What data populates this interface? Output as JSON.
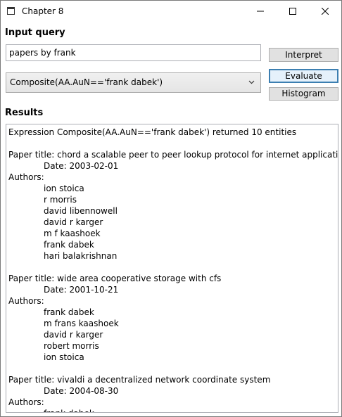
{
  "window": {
    "title": "Chapter 8",
    "minimize_glyph": "—",
    "maximize_glyph": "☐",
    "close_glyph": "✕"
  },
  "input_section": {
    "label": "Input query",
    "query_value": "papers by frank",
    "interpret_label": "Interpret"
  },
  "combo": {
    "selected": "Composite(AA.AuN=='frank dabek')"
  },
  "buttons": {
    "evaluate_label": "Evaluate",
    "histogram_label": "Histogram"
  },
  "results": {
    "label": "Results",
    "summary": "Expression Composite(AA.AuN=='frank dabek') returned 10 entities",
    "papers": [
      {
        "title_line": "Paper title: chord a scalable peer to peer lookup protocol for internet applications",
        "date_line": "Date: 2003-02-01",
        "authors_label": "Authors:",
        "authors": [
          "ion stoica",
          "r morris",
          "david libennowell",
          "david r karger",
          "m f kaashoek",
          "frank dabek",
          "hari balakrishnan"
        ]
      },
      {
        "title_line": "Paper title: wide area cooperative storage with cfs",
        "date_line": "Date: 2001-10-21",
        "authors_label": "Authors:",
        "authors": [
          "frank dabek",
          "m frans kaashoek",
          "david r karger",
          "robert morris",
          "ion stoica"
        ]
      },
      {
        "title_line": "Paper title: vivaldi a decentralized network coordinate system",
        "date_line": "Date: 2004-08-30",
        "authors_label": "Authors:",
        "authors": [
          "frank dabek"
        ]
      }
    ]
  }
}
